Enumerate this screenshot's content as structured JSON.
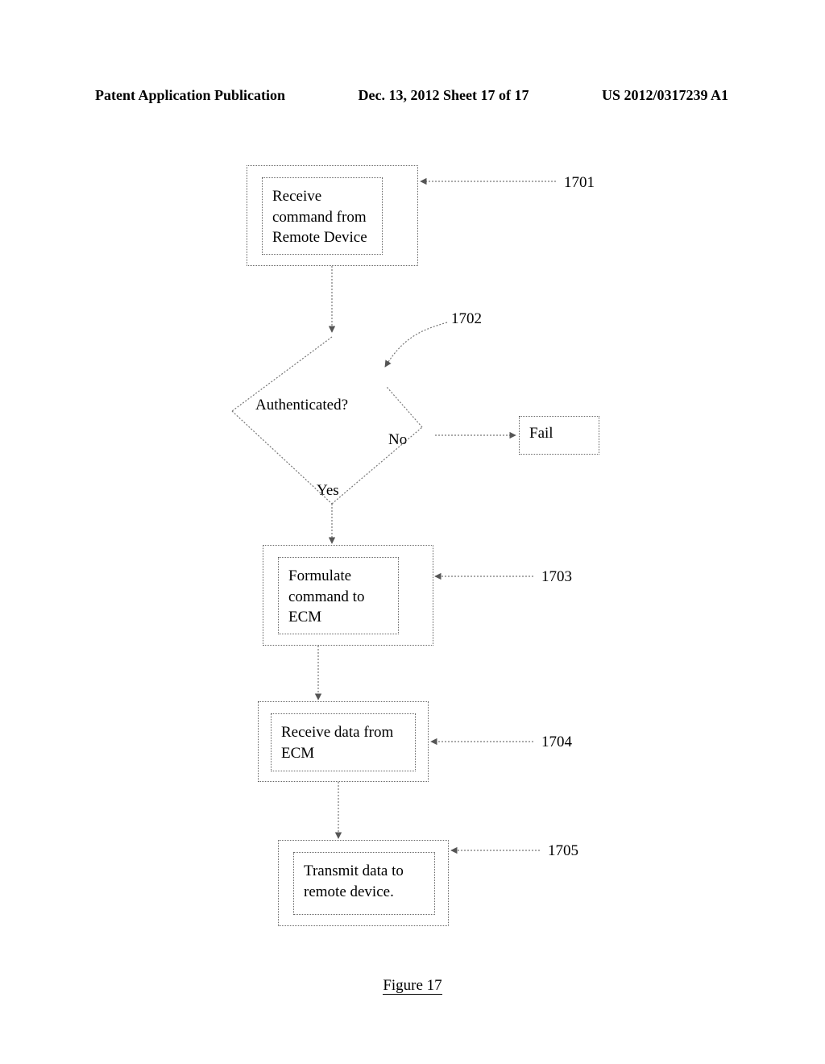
{
  "header": {
    "left": "Patent Application Publication",
    "mid": "Dec. 13, 2012  Sheet 17 of 17",
    "right": "US 2012/0317239 A1"
  },
  "steps": {
    "s1": "Receive command from Remote Device",
    "s2": "Authenticated?",
    "s2no": "No",
    "s2yes": "Yes",
    "fail": "Fail",
    "s3": "Formulate command to ECM",
    "s4": "Receive data from ECM",
    "s5": "Transmit data to remote device."
  },
  "refs": {
    "r1": "1701",
    "r2": "1702",
    "r3": "1703",
    "r4": "1704",
    "r5": "1705"
  },
  "figure": "Figure 17"
}
